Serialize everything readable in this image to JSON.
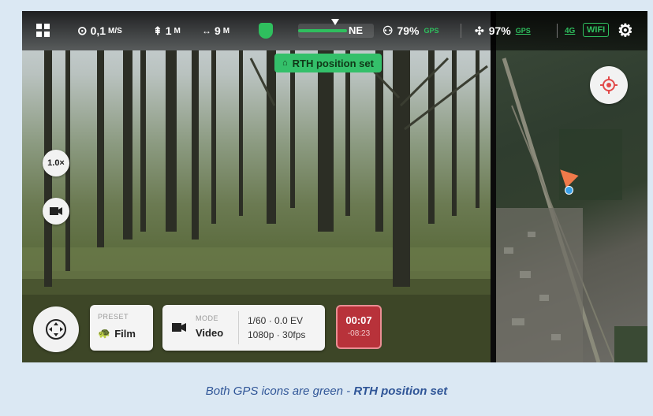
{
  "topbar": {
    "speed_value": "0,1",
    "speed_unit": "M/S",
    "altitude_value": "1",
    "altitude_unit": "M",
    "distance_value": "9",
    "distance_unit": "M",
    "compass_heading": "NE",
    "drone_battery": "79%",
    "drone_gps_label": "GPS",
    "controller_battery": "97%",
    "controller_gps_label": "GPS",
    "network_label": "4G",
    "wifi_label": "WIFI"
  },
  "rth_banner": "RTH position set",
  "zoom_label": "1.0×",
  "preset": {
    "label": "PRESET",
    "value": "Film"
  },
  "mode": {
    "label": "MODE",
    "value": "Video"
  },
  "exposure": {
    "line1": "1/60 · 0.0 EV",
    "line2": "1080p · 30fps"
  },
  "record": {
    "elapsed": "00:07",
    "remaining": "-08:23"
  },
  "caption": {
    "text": "Both GPS icons are green - ",
    "emphasis": "RTH position set"
  },
  "colors": {
    "accent_green": "#2fbf5e",
    "record_red": "#b8323a",
    "caption_blue": "#2f5597"
  }
}
